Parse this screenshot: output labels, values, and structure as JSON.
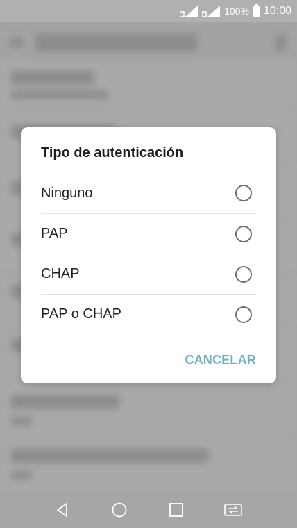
{
  "status_bar": {
    "battery_percent": "100%",
    "time": "10:00",
    "icons": [
      "signal-icon",
      "signal-icon",
      "battery-icon"
    ]
  },
  "dialog": {
    "title": "Tipo de autenticación",
    "options": [
      {
        "label": "Ninguno",
        "selected": false
      },
      {
        "label": "PAP",
        "selected": false
      },
      {
        "label": "CHAP",
        "selected": false
      },
      {
        "label": "PAP o CHAP",
        "selected": false
      }
    ],
    "cancel_label": "CANCELAR"
  },
  "nav_bar": {
    "icons": [
      "back-icon",
      "home-icon",
      "recents-icon",
      "switch-sim-icon"
    ]
  },
  "colors": {
    "accent": "#6fb1bd",
    "dialog_bg": "#ffffff",
    "background": "#adadad"
  }
}
